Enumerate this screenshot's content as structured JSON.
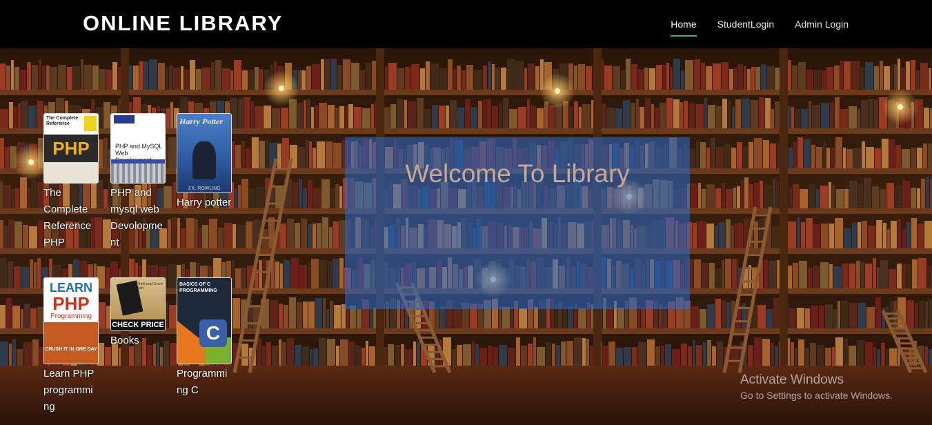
{
  "header": {
    "brand": "ONLINE LIBRARY",
    "nav": [
      {
        "label": "Home",
        "active": true
      },
      {
        "label": "StudentLogin",
        "active": false
      },
      {
        "label": "Admin Login",
        "active": false
      }
    ]
  },
  "books": [
    {
      "title": "The Complete Reference PHP",
      "cover": {
        "top": "The Complete Reference",
        "main": "PHP"
      }
    },
    {
      "title": "PHP and mysql web Devolopment",
      "cover": {
        "top": "PHP and MySQL Web Development"
      }
    },
    {
      "title": "Harry potter",
      "cover": {
        "top": "Harry Potter",
        "bottom": "J.K. ROWLING"
      }
    },
    {
      "title": "Learn PHP programming",
      "cover": {
        "top": "LEARN",
        "main": "PHP",
        "sub": "Programming",
        "bottom": "CRUSH IT IN ONE DAY"
      }
    },
    {
      "title": "Books",
      "cover": {
        "top": "Think and Grow Rich",
        "bottom": "CHECK PRICE"
      }
    },
    {
      "title": "Programming C",
      "cover": {
        "top": "BASICS OF C PROGRAMMING",
        "main": "C"
      }
    }
  ],
  "welcome": {
    "text": "Welcome To Library"
  },
  "watermark": {
    "title": "Activate Windows",
    "subtitle": "Go to Settings to activate Windows."
  },
  "colors": {
    "navbar": "#000000",
    "active_underline": "#2bb3a3",
    "welcome_panel": "#286ed2"
  }
}
